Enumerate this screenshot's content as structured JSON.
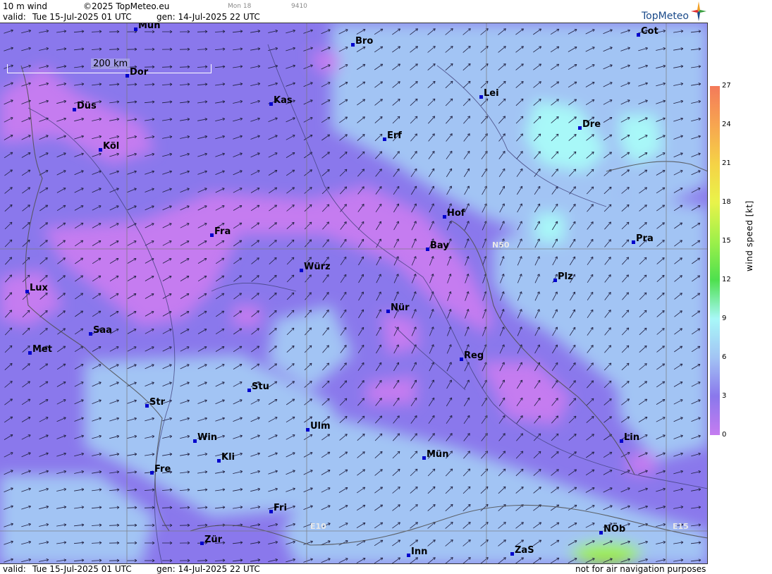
{
  "header": {
    "product": "10 m wind",
    "copyright": "©2025 TopMeteo.eu",
    "small_day": "Mon 18",
    "small_code": "9410",
    "valid_label": "valid:",
    "valid_time": "Tue  15-Jul-2025  01 UTC",
    "gen": "gen: 14-Jul-2025 22 UTC",
    "logo": "TopMeteo"
  },
  "footer": {
    "valid_label": "valid:",
    "valid_time": "Tue  15-Jul-2025  01 UTC",
    "gen": "gen: 14-Jul-2025 22 UTC",
    "disclaimer": "not for air navigation purposes"
  },
  "map": {
    "scale_label": "200 km",
    "grid_labels": {
      "n50": "N50",
      "e10": "E10",
      "e15": "E15"
    },
    "cities": [
      {
        "name": "Mün",
        "id": "top-mun"
      },
      {
        "name": "Bro"
      },
      {
        "name": "Cot"
      },
      {
        "name": "Dor"
      },
      {
        "name": "Kas"
      },
      {
        "name": "Lei"
      },
      {
        "name": "Düs"
      },
      {
        "name": "Dre"
      },
      {
        "name": "Erf"
      },
      {
        "name": "Köl"
      },
      {
        "name": "Hof"
      },
      {
        "name": "Fra"
      },
      {
        "name": "Pra"
      },
      {
        "name": "Bay"
      },
      {
        "name": "Würz"
      },
      {
        "name": "Plz"
      },
      {
        "name": "Lux"
      },
      {
        "name": "Nür"
      },
      {
        "name": "Saa"
      },
      {
        "name": "Met"
      },
      {
        "name": "Reg"
      },
      {
        "name": "Stu"
      },
      {
        "name": "Str"
      },
      {
        "name": "Ulm"
      },
      {
        "name": "Lin"
      },
      {
        "name": "Win"
      },
      {
        "name": "Kli"
      },
      {
        "name": "Mün"
      },
      {
        "name": "Fre"
      },
      {
        "name": "Fri"
      },
      {
        "name": "NÖb"
      },
      {
        "name": "Zür"
      },
      {
        "name": "ZaS"
      },
      {
        "name": "Inn"
      }
    ]
  },
  "legend": {
    "title": "wind speed [kt]",
    "ticks": [
      "27",
      "24",
      "21",
      "18",
      "15",
      "12",
      "9",
      "6",
      "3",
      "0"
    ],
    "colors": [
      "#f47a5a",
      "#f7a550",
      "#f5d246",
      "#e9f34a",
      "#9ef04a",
      "#4ee04e",
      "#a8f8f8",
      "#a2c4f4",
      "#8a78ec",
      "#c57cf0"
    ]
  }
}
